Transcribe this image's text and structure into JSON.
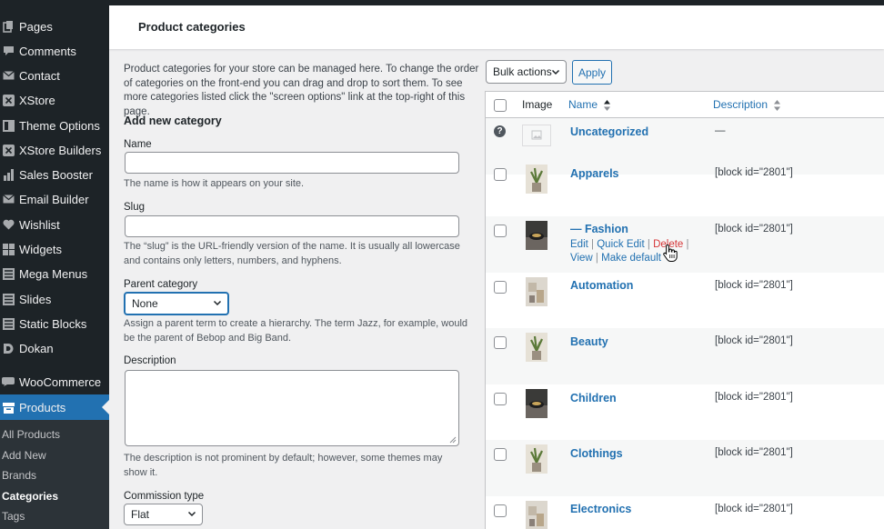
{
  "sidebar": {
    "items": [
      {
        "label": "Pages",
        "icon": "pages-icon"
      },
      {
        "label": "Comments",
        "icon": "comments-icon"
      },
      {
        "label": "Contact",
        "icon": "contact-icon"
      },
      {
        "label": "XStore",
        "icon": "xstore-icon"
      },
      {
        "label": "Theme Options",
        "icon": "theme-options-icon"
      },
      {
        "label": "XStore Builders",
        "icon": "xstore-builders-icon"
      },
      {
        "label": "Sales Booster",
        "icon": "sales-booster-icon"
      },
      {
        "label": "Email Builder",
        "icon": "email-builder-icon"
      },
      {
        "label": "Wishlist",
        "icon": "heart-icon"
      },
      {
        "label": "Widgets",
        "icon": "widgets-icon"
      },
      {
        "label": "Mega Menus",
        "icon": "mega-menus-icon"
      },
      {
        "label": "Slides",
        "icon": "slides-icon"
      },
      {
        "label": "Static Blocks",
        "icon": "static-blocks-icon"
      },
      {
        "label": "Dokan",
        "icon": "dokan-icon"
      },
      {
        "label": "WooCommerce",
        "icon": "woocommerce-icon"
      },
      {
        "label": "Products",
        "icon": "products-icon"
      }
    ],
    "submenu": [
      "All Products",
      "Add New",
      "Brands",
      "Categories",
      "Tags"
    ],
    "current_submenu": "Categories"
  },
  "header": {
    "title": "Product categories"
  },
  "form": {
    "intro": "Product categories for your store can be managed here. To change the order of categories on the front-end you can drag and drop to sort them. To see more categories listed click the \"screen options\" link at the top-right of this page.",
    "section_title": "Add new category",
    "name_label": "Name",
    "name_help": "The name is how it appears on your site.",
    "slug_label": "Slug",
    "slug_help": "The “slug” is the URL-friendly version of the name. It is usually all lowercase and contains only letters, numbers, and hyphens.",
    "parent_label": "Parent category",
    "parent_value": "None",
    "parent_help": "Assign a parent term to create a hierarchy. The term Jazz, for example, would be the parent of Bebop and Big Band.",
    "description_label": "Description",
    "description_help": "The description is not prominent by default; however, some themes may show it.",
    "commission_label": "Commission type",
    "commission_value": "Flat"
  },
  "table": {
    "bulk_actions": "Bulk actions",
    "apply": "Apply",
    "col_image": "Image",
    "col_name": "Name",
    "col_description": "Description",
    "rows": [
      {
        "name": "Uncategorized",
        "description": "—"
      },
      {
        "name": "Apparels",
        "description": "[block id=\"2801\"]"
      },
      {
        "name": "— Fashion",
        "description": "[block id=\"2801\"]"
      },
      {
        "name": "Automation",
        "description": "[block id=\"2801\"]"
      },
      {
        "name": "Beauty",
        "description": "[block id=\"2801\"]"
      },
      {
        "name": "Children",
        "description": "[block id=\"2801\"]"
      },
      {
        "name": "Clothings",
        "description": "[block id=\"2801\"]"
      },
      {
        "name": "Electronics",
        "description": "[block id=\"2801\"]"
      }
    ],
    "row_actions": {
      "edit": "Edit",
      "quick_edit": "Quick Edit",
      "delete": "Delete",
      "view": "View",
      "make_default": "Make default",
      "separator": "|"
    }
  },
  "colors": {
    "accent": "#2271b1",
    "sidebar_bg": "#1d2327",
    "danger": "#d63638"
  }
}
